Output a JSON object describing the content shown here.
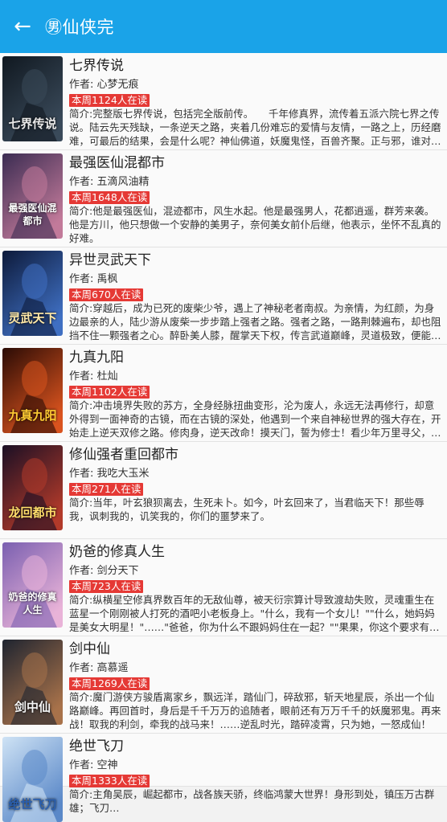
{
  "header": {
    "title": "㊚仙侠完",
    "back_icon": "arrow-left-icon",
    "color": "#1aa3e8"
  },
  "badge_color": "#e53935",
  "books": [
    {
      "title": "七界传说",
      "author": "作者: 心梦无痕",
      "readers": "本周1124人在读",
      "intro": "简介:完整版七界传说，包括完全版前传。　　千年修真界，流传着五派六院七界之传说。陆云先天残缺，一条逆天之路，夹着几份难忘的爱情与友情，一路之上，历经磨难，可最后的结果，会是什么呢？神仙佛道，妖魔鬼怪，百兽齐聚。正与邪，谁对谁错，是与非善恶无常。…",
      "cover_text": "七界传说"
    },
    {
      "title": "最强医仙混都市",
      "author": "作者: 五滴风油精",
      "readers": "本周1648人在读",
      "intro": "简介:他是最强医仙，混迹都市，风生水起。他是最强男人，花都逍遥，群芳来袭。他是方川，他只想做一个安静的美男子，奈何美女前仆后继，他表示，坐怀不乱真的好难。",
      "cover_text": "最强医仙混都市"
    },
    {
      "title": "异世灵武天下",
      "author": "作者: 禹枫",
      "readers": "本周670人在读",
      "intro": "简介:穿越后，成为已死的废柴少爷，遇上了神秘老者南叔。为亲情，为红颜，为身边最亲的人，陆少游从废柴一步步踏上强者之路。强者之路，一路荆棘遍布，却也阻挡不住一颗强者之心。醉卧美人膝，醒掌天下权，传言武道巅峰，灵道极致，便能踏碎虚空。灵武双修，不世…",
      "cover_text": "灵武天下"
    },
    {
      "title": "九真九阳",
      "author": "作者: 杜灿",
      "readers": "本周1102人在读",
      "intro": "简介:冲击境界失败的苏方，全身经脉扭曲变形，沦为废人，永远无法再修行，却意外得到一面神奇的古镜，而在古镜的深处，他遇到一个来自神秘世界的强大存在，开始走上逆天双修之路。修肉身，逆天改命！摸天门，誓为修士！看少年万里寻父，一步步在万千天才之中脱颖…",
      "cover_text": "九真九阳"
    },
    {
      "title": "修仙强者重回都市",
      "author": "作者: 我吃大玉米",
      "readers": "本周271人在读",
      "intro": "简介:当年，叶玄狼狈离去，生死未卜。如今，叶玄回来了，当君临天下！那些辱我，讽刺我的，讥笑我的，你们的噩梦来了。",
      "cover_text": "龙回都市"
    },
    {
      "title": "奶爸的修真人生",
      "author": "作者: 剑分天下",
      "readers": "本周723人在读",
      "intro": "简介:纵横星空修真界数百年的无敌仙尊，被天衍宗算计导致渡劫失败，灵魂重生在蓝星一个刚刚被人打死的酒吧小老板身上。\"什么，我有一个女儿！\"\"什么，她妈妈是美女大明星！\"……\"爸爸，你为什么不跟妈妈住在一起？\"\"果果，你这个要求有点高啊！\"会修仙，会医术，会炼丹…",
      "cover_text": "奶爸的修真人生"
    },
    {
      "title": "剑中仙",
      "author": "作者: 高慕遥",
      "readers": "本周1269人在读",
      "intro": "简介:魔门游侠方骏盾离家乡，飘远洋，踏仙门，碎敌邪，斩天地星辰，杀出一个仙路巅峰。再回首时，身后是千千万万的追随者，眼前还有万万千千的妖魔邪鬼。再来战！取我的利剑，牵我的战马来！……逆乱时光，踏碎凌霄，只为她，一怒成仙！",
      "cover_text": "剑中仙"
    },
    {
      "title": "绝世飞刀",
      "author": "作者: 空神",
      "readers": "本周1333人在读",
      "intro": "简介:主角吴辰，崛起都市，战各族天骄，终临鸿蒙大世界！身形到处，镇压万古群雄；飞刀…",
      "cover_text": "绝世飞刀"
    }
  ]
}
